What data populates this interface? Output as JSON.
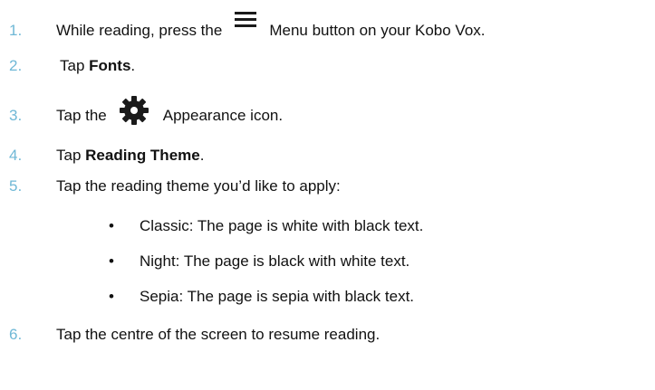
{
  "steps": [
    {
      "number": "1.",
      "before": "While reading, press the",
      "icon": "menu-icon",
      "after": "Menu button on your Kobo Vox."
    },
    {
      "number": "2.",
      "before": "Tap ",
      "bold": "Fonts",
      "after": "."
    },
    {
      "number": "3.",
      "before": "Tap the",
      "icon": "gear-icon",
      "after": "Appearance icon."
    },
    {
      "number": "4.",
      "before": "Tap ",
      "bold": "Reading Theme",
      "after": "."
    },
    {
      "number": "5.",
      "text": "Tap the reading theme you’d like to apply:"
    },
    {
      "number": "6.",
      "text": "Tap the centre of the screen to resume reading."
    }
  ],
  "bullets": [
    {
      "dot": "•",
      "text": "Classic: The page is white with black text."
    },
    {
      "dot": "•",
      "text": "Night: The page is black with white text."
    },
    {
      "dot": "•",
      "text": "Sepia: The page is sepia with black text."
    }
  ],
  "colors": {
    "number": "#6fb8d6",
    "text": "#111111",
    "background": "#ffffff"
  }
}
